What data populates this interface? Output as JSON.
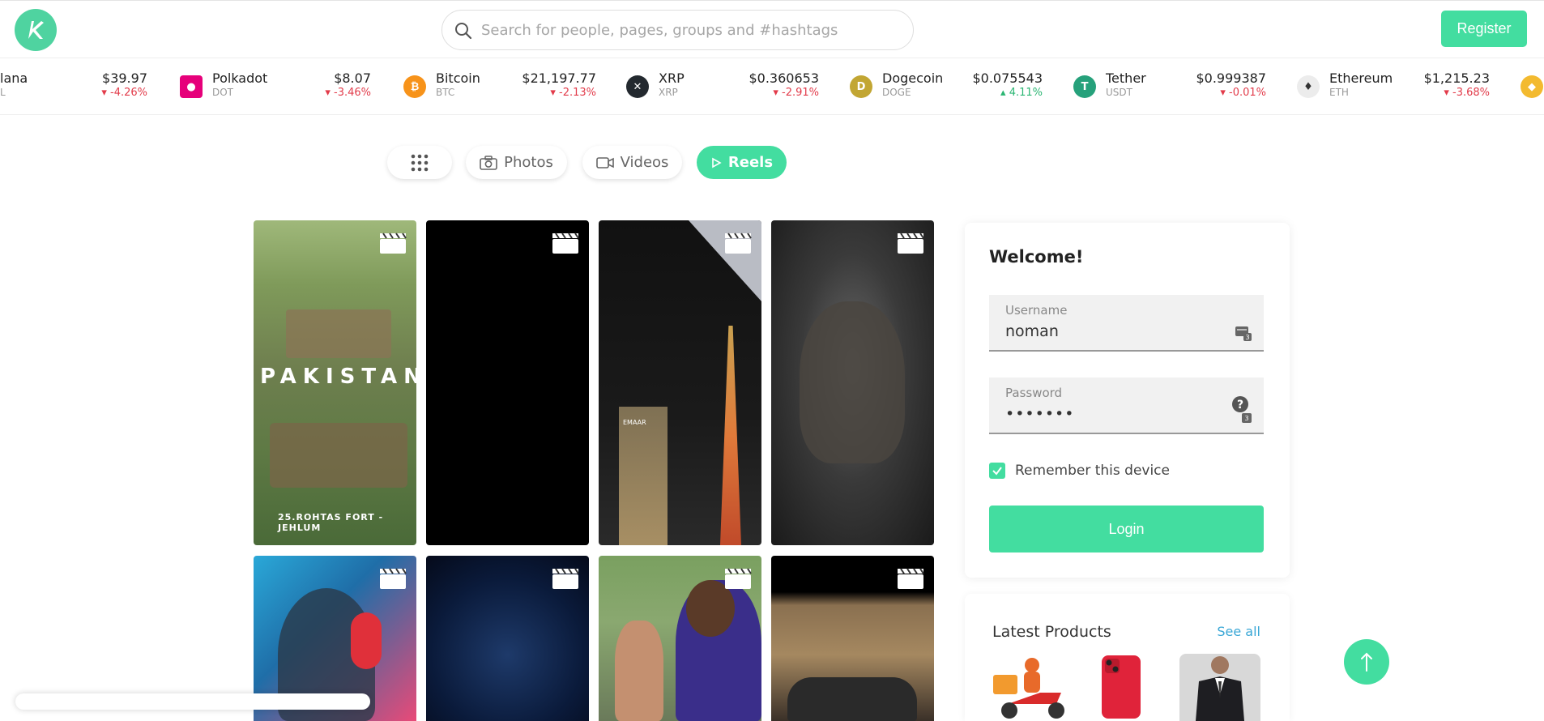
{
  "header": {
    "search_placeholder": "Search for people, pages, groups and #hashtags",
    "register_label": "Register"
  },
  "ticker": [
    {
      "name": "lana",
      "symbol": "L",
      "price": "$39.97",
      "change": "-4.26%",
      "dir": "down"
    },
    {
      "name": "Polkadot",
      "symbol": "DOT",
      "price": "$8.07",
      "change": "-3.46%",
      "dir": "down"
    },
    {
      "name": "Bitcoin",
      "symbol": "BTC",
      "price": "$21,197.77",
      "change": "-2.13%",
      "dir": "down"
    },
    {
      "name": "XRP",
      "symbol": "XRP",
      "price": "$0.360653",
      "change": "-2.91%",
      "dir": "down"
    },
    {
      "name": "Dogecoin",
      "symbol": "DOGE",
      "price": "$0.075543",
      "change": "4.11%",
      "dir": "up"
    },
    {
      "name": "Tether",
      "symbol": "USDT",
      "price": "$0.999387",
      "change": "-0.01%",
      "dir": "down"
    },
    {
      "name": "Ethereum",
      "symbol": "ETH",
      "price": "$1,215.23",
      "change": "-3.68%",
      "dir": "down"
    }
  ],
  "tabs": {
    "photos": "Photos",
    "videos": "Videos",
    "reels": "Reels"
  },
  "reels": {
    "caption_word": "PAKISTAN",
    "caption_location": "25.ROHTAS FORT - JEHLUM",
    "building_sign": "EMAAR"
  },
  "login": {
    "title": "Welcome!",
    "username_label": "Username",
    "username_value": "noman",
    "password_label": "Password",
    "password_value": "•••••••",
    "remember_label": "Remember this device",
    "remember_checked": true,
    "login_label": "Login"
  },
  "products": {
    "title": "Latest Products",
    "see_all": "See all"
  },
  "colors": {
    "accent": "#43dda0",
    "down": "#e23b4a",
    "up": "#2bb673"
  }
}
